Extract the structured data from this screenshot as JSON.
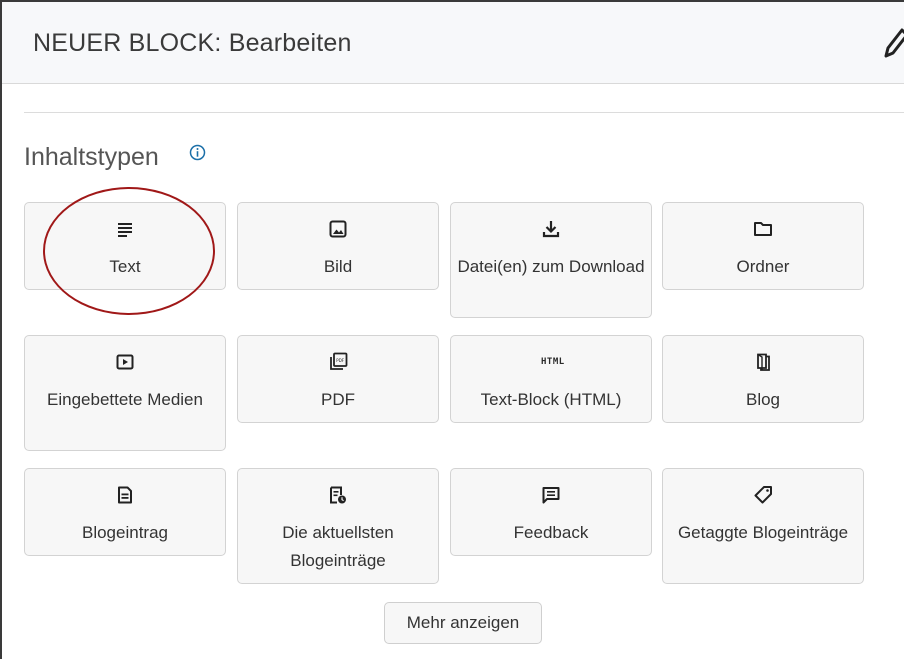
{
  "header": {
    "title": "NEUER BLOCK: Bearbeiten",
    "edit_icon": "pencil-icon"
  },
  "section": {
    "title": "Inhaltstypen",
    "info_icon": "info-icon"
  },
  "content_types": [
    {
      "label": "Text",
      "icon": "text-lines-icon"
    },
    {
      "label": "Bild",
      "icon": "image-icon"
    },
    {
      "label": "Datei(en) zum Download",
      "icon": "download-icon"
    },
    {
      "label": "Ordner",
      "icon": "folder-icon"
    },
    {
      "label": "Eingebettete Medien",
      "icon": "play-icon"
    },
    {
      "label": "PDF",
      "icon": "pdf-icon"
    },
    {
      "label": "Text-Block (HTML)",
      "icon": "html-icon",
      "icon_text": "HTML"
    },
    {
      "label": "Blog",
      "icon": "blog-icon"
    },
    {
      "label": "Blogeintrag",
      "icon": "blog-post-icon"
    },
    {
      "label": "Die aktuellsten Blogeinträge",
      "icon": "recent-posts-icon"
    },
    {
      "label": "Feedback",
      "icon": "feedback-icon"
    },
    {
      "label": "Getaggte Blogeinträge",
      "icon": "tag-icon"
    }
  ],
  "more_button": {
    "label": "Mehr anzeigen"
  },
  "colors": {
    "header_bg": "#f7f8fa",
    "tile_bg": "#f7f7f7",
    "highlight": "#a01818",
    "info": "#1b6fa8"
  }
}
